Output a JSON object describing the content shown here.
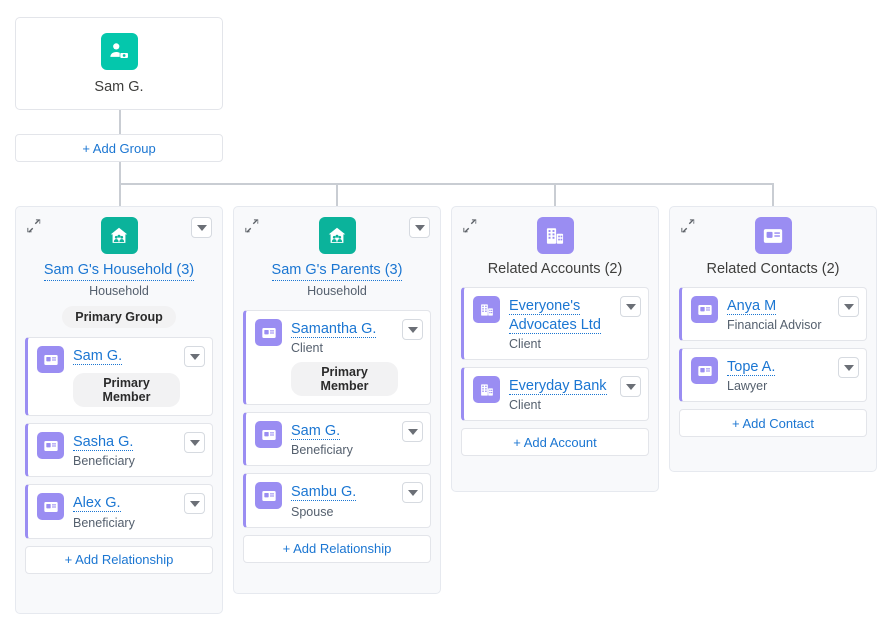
{
  "root": {
    "label": "Sam G.",
    "icon": "client-person-icon"
  },
  "add_group": {
    "label": "+ Add Group"
  },
  "colors": {
    "link": "#1b76d2",
    "teal": "#04c7ac",
    "purple": "#9a8df2",
    "card_bg": "#f8f9fb",
    "connector": "#c9cdd3",
    "badge_bg": "#f2f2f3"
  },
  "cards": [
    {
      "title": "Sam G's Household (3)",
      "title_is_link": true,
      "subtitle": "Household",
      "badge": "Primary Group",
      "icon": "household-icon",
      "icon_color": "teal",
      "collapse_icon": "collapse-icon",
      "caret_icon": "chevron-down-icon",
      "rows": [
        {
          "name": "Sam G.",
          "role": "",
          "badge": "Primary Member",
          "icon": "contact-card-icon"
        },
        {
          "name": "Sasha G.",
          "role": "Beneficiary",
          "badge": "",
          "icon": "contact-card-icon"
        },
        {
          "name": "Alex G.",
          "role": "Beneficiary",
          "badge": "",
          "icon": "contact-card-icon"
        }
      ],
      "add_label": "+ Add Relationship"
    },
    {
      "title": "Sam G's Parents (3)",
      "title_is_link": true,
      "subtitle": "Household",
      "badge": "",
      "icon": "household-icon",
      "icon_color": "teal",
      "collapse_icon": "collapse-icon",
      "caret_icon": "chevron-down-icon",
      "rows": [
        {
          "name": "Samantha G.",
          "role": "Client",
          "badge": "Primary Member",
          "icon": "contact-card-icon"
        },
        {
          "name": "Sam G.",
          "role": "Beneficiary",
          "badge": "",
          "icon": "contact-card-icon"
        },
        {
          "name": "Sambu G.",
          "role": "Spouse",
          "badge": "",
          "icon": "contact-card-icon"
        }
      ],
      "add_label": "+ Add Relationship"
    },
    {
      "title": "Related Accounts (2)",
      "title_is_link": false,
      "subtitle": "",
      "badge": "",
      "icon": "account-building-icon",
      "icon_color": "purple",
      "collapse_icon": "collapse-icon",
      "caret_icon": "chevron-down-icon",
      "rows": [
        {
          "name": "Everyone's Advocates Ltd",
          "role": "Client",
          "badge": "",
          "icon": "account-building-icon"
        },
        {
          "name": "Everyday Bank",
          "role": "Client",
          "badge": "",
          "icon": "account-building-icon"
        }
      ],
      "add_label": "+ Add Account"
    },
    {
      "title": "Related Contacts (2)",
      "title_is_link": false,
      "subtitle": "",
      "badge": "",
      "icon": "contact-card-icon",
      "icon_color": "purple",
      "collapse_icon": "collapse-icon",
      "caret_icon": "chevron-down-icon",
      "rows": [
        {
          "name": "Anya M",
          "role": "Financial Advisor",
          "badge": "",
          "icon": "contact-card-icon"
        },
        {
          "name": "Tope A.",
          "role": "Lawyer",
          "badge": "",
          "icon": "contact-card-icon"
        }
      ],
      "add_label": "+ Add Contact"
    }
  ]
}
